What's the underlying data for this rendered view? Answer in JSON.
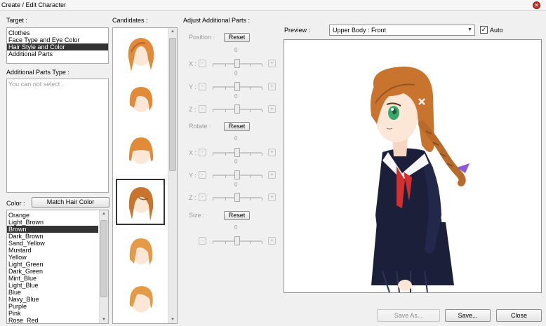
{
  "window": {
    "title": "Create / Edit Character"
  },
  "target": {
    "label": "Target :",
    "items": [
      "Clothes",
      "Face Type and Eye Color",
      "Hair Style and Color",
      "Additional Parts"
    ],
    "selected_index": 2
  },
  "additional_parts_type": {
    "label": "Additional Parts Type :",
    "placeholder": "You can not select ."
  },
  "color": {
    "label": "Color :",
    "match_button": "Match Hair Color",
    "items": [
      "Orange",
      "Light_Brown",
      "Brown",
      "Dark_Brown",
      "Sand_Yellow",
      "Mustard",
      "Yellow",
      "Light_Green",
      "Dark_Green",
      "Mint_Blue",
      "Light_Blue",
      "Blue",
      "Navy_Blue",
      "Purple",
      "Pink",
      "Rose_Red"
    ],
    "selected_index": 2
  },
  "candidates": {
    "label": "Candidates :",
    "count": 6,
    "selected_index": 3
  },
  "adjust": {
    "label": "Adjust Additional Parts :",
    "position": {
      "label": "Position :",
      "reset": "Reset"
    },
    "rotate": {
      "label": "Rotate :",
      "reset": "Reset"
    },
    "size": {
      "label": "Size :",
      "reset": "Reset"
    },
    "axes": [
      "X :",
      "Y :",
      "Z :"
    ],
    "zero": "0",
    "minus": "-",
    "plus": "+"
  },
  "preview": {
    "label": "Preview :",
    "view_selected": "Upper Body : Front",
    "auto_label": "Auto",
    "auto_checked": true
  },
  "buttons": {
    "save_as": "Save As...",
    "save": "Save...",
    "close": "Close"
  },
  "colors": {
    "hair": "#c8742e",
    "hair_shadow": "#9a5420",
    "skin": "#fce7d6",
    "uniform": "#1b1f3a",
    "ribbon": "#d23030",
    "eyes": "#3aa86e",
    "hairtie": "#8a5ad8",
    "selection": "#333333"
  }
}
